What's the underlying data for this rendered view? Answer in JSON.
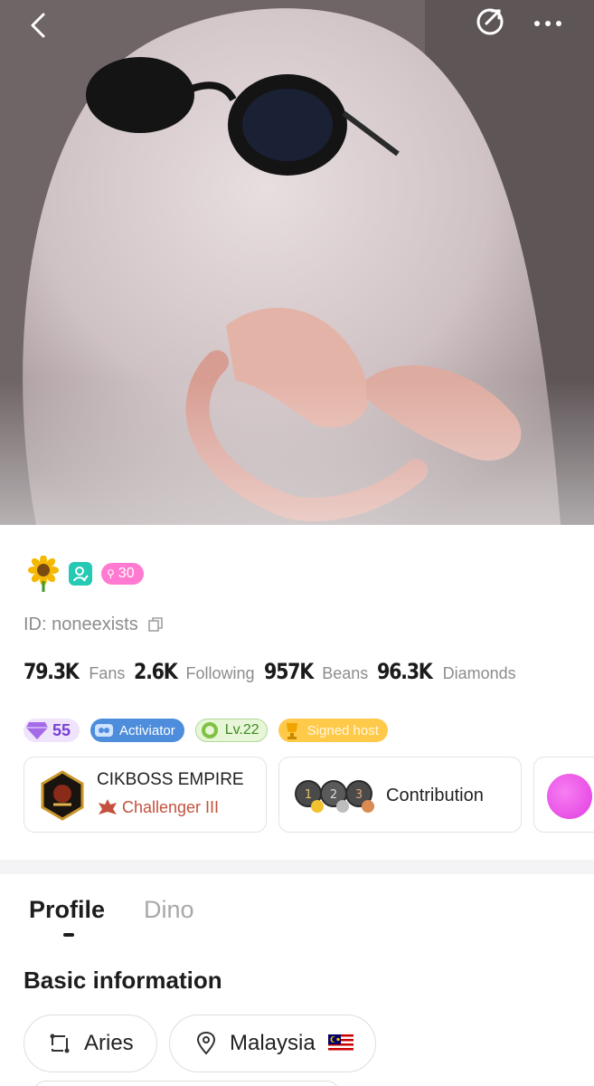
{
  "header": {
    "back_icon": "chevron-left-icon",
    "share_icon": "share-arrow-icon",
    "more_icon": "more-dots-icon"
  },
  "profile": {
    "avatar_badge_icon": "sunflower-icon",
    "verified_icon": "verified-person-icon",
    "level_badge": "30",
    "id_text": "ID: noneexists",
    "stats": [
      {
        "value": "79.3K",
        "label": "Fans"
      },
      {
        "value": "2.6K",
        "label": "Following"
      },
      {
        "value": "957K",
        "label": "Beans"
      },
      {
        "value": "96.3K",
        "label": "Diamonds"
      }
    ],
    "tags": {
      "diamond": "55",
      "activator": "Activiator",
      "level": "Lv.22",
      "host": "Signed host"
    }
  },
  "cards": {
    "family_name": "CIKBOSS EMPIRE",
    "family_rank": "Challenger III",
    "contribution_label": "Contribution",
    "medals": [
      "1",
      "2",
      "3"
    ]
  },
  "tabs": [
    {
      "label": "Profile",
      "active": true
    },
    {
      "label": "Dino",
      "active": false
    }
  ],
  "basic_info": {
    "title": "Basic information",
    "zodiac": "Aries",
    "country": "Malaysia"
  },
  "colors": {
    "accent_pink": "#ff7ad0",
    "teal": "#25c9b4",
    "rank_red": "#c4513d"
  }
}
